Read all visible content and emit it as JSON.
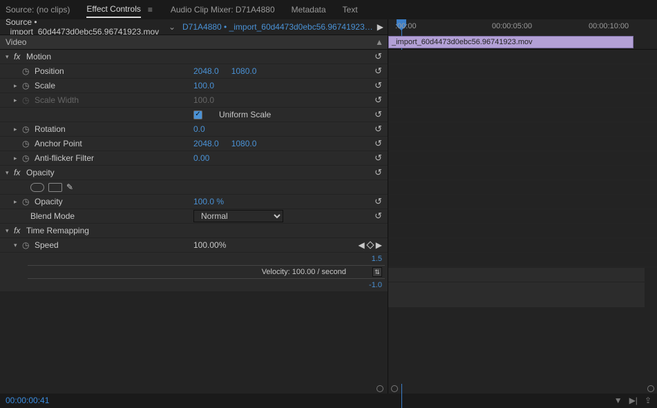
{
  "tabs": {
    "source": "Source: (no clips)",
    "effect": "Effect Controls",
    "mixer": "Audio Clip Mixer: D71A4880",
    "metadata": "Metadata",
    "text": "Text"
  },
  "source_line": {
    "prefix": "Source • _import_60d4473d0ebc56.96741923.mov",
    "seq": "D71A4880",
    "clip": "_import_60d4473d0ebc56.96741923…"
  },
  "sections": {
    "video": "Video",
    "motion": "Motion",
    "opacity": "Opacity",
    "remap": "Time Remapping"
  },
  "props": {
    "position": {
      "label": "Position",
      "x": "2048.0",
      "y": "1080.0"
    },
    "scale": {
      "label": "Scale",
      "v": "100.0"
    },
    "scalew": {
      "label": "Scale Width",
      "v": "100.0"
    },
    "uniform": {
      "label": "Uniform Scale"
    },
    "rotation": {
      "label": "Rotation",
      "v": "0.0"
    },
    "anchor": {
      "label": "Anchor Point",
      "x": "2048.0",
      "y": "1080.0"
    },
    "flicker": {
      "label": "Anti-flicker Filter",
      "v": "0.00"
    },
    "opacity": {
      "label": "Opacity",
      "v": "100.0 %"
    },
    "blend": {
      "label": "Blend Mode",
      "v": "Normal"
    },
    "speed": {
      "label": "Speed",
      "v": "100.00%"
    }
  },
  "velocity": {
    "upper": "1.5",
    "text": "Velocity: 100.00 / second",
    "lower": "-1.0"
  },
  "timeline": {
    "t0": ":00:00",
    "t1": "00:00:05:00",
    "t2": "00:00:10:00",
    "clip": "_import_60d4473d0ebc56.96741923.mov"
  },
  "footer": {
    "timecode": "00:00:00:41"
  }
}
